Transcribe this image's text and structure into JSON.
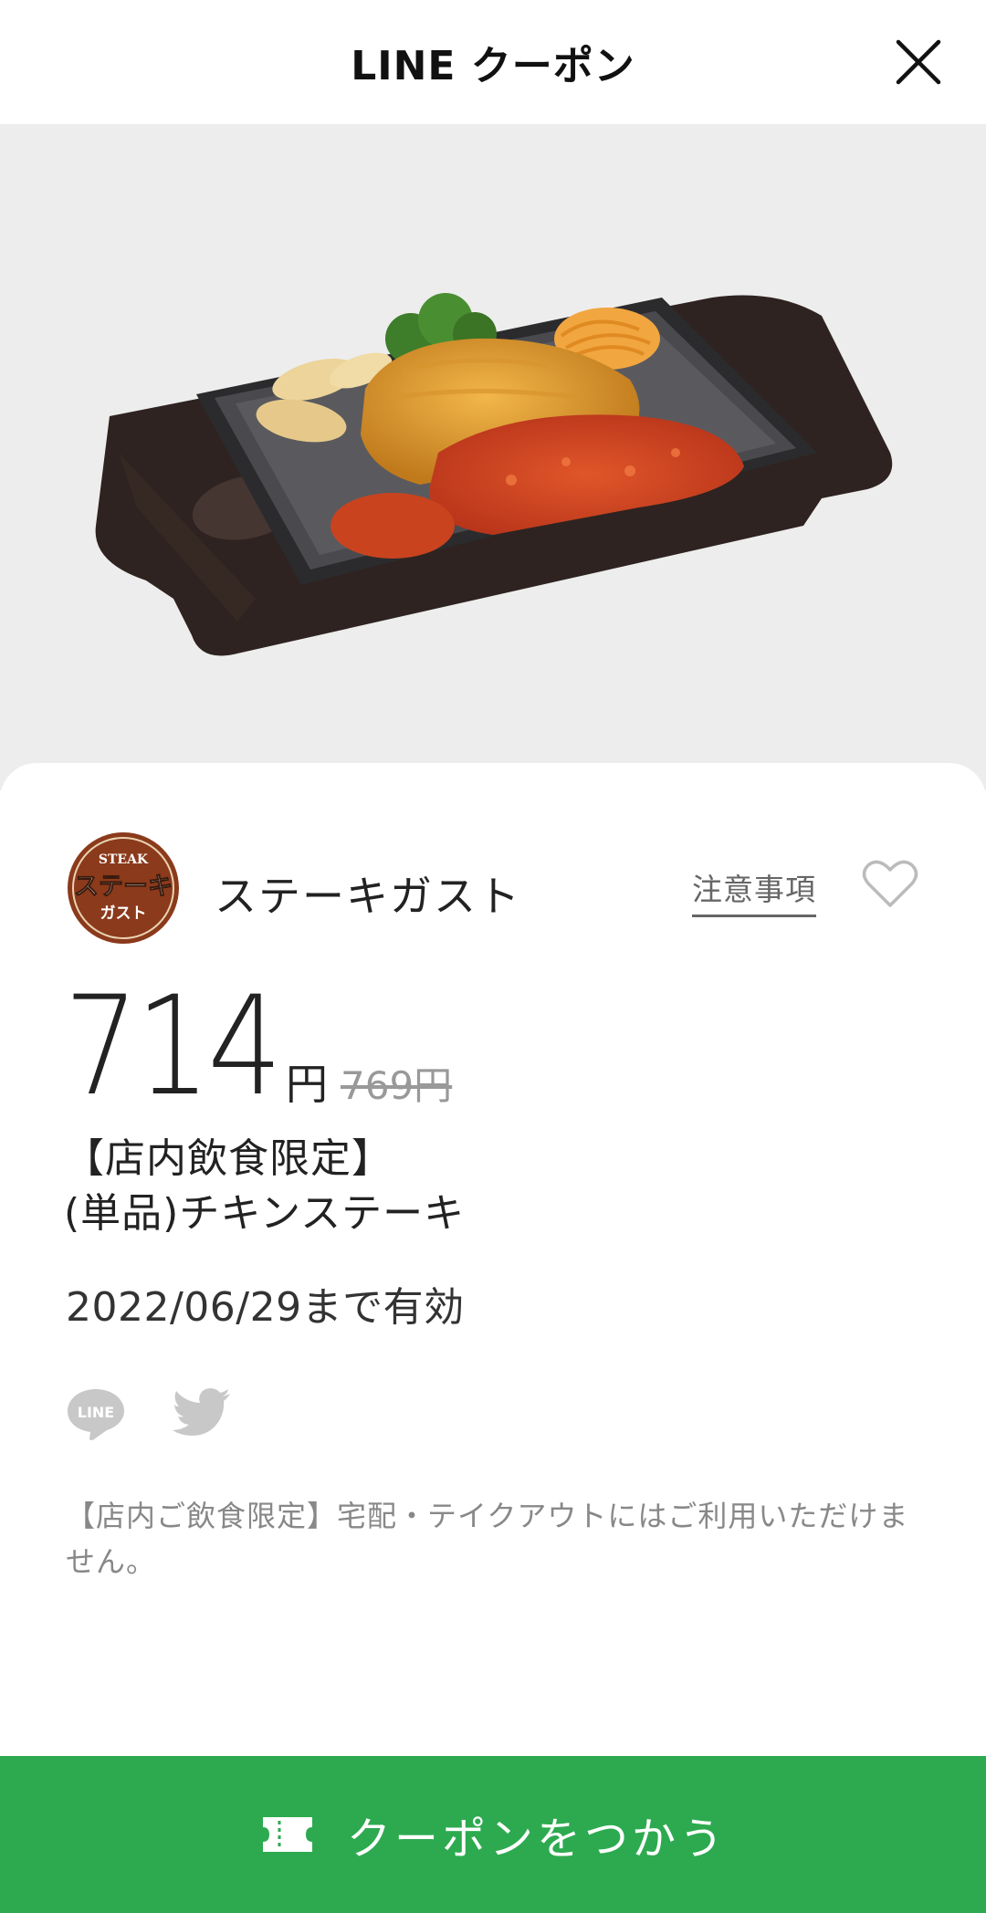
{
  "header": {
    "title": "LINE クーポン"
  },
  "shop": {
    "logo_text_top": "STEAK",
    "logo_text_mid": "ステーキ",
    "logo_text_bottom": "ガスト",
    "name": "ステーキガスト",
    "notice_label": "注意事項"
  },
  "price": {
    "current": "714",
    "unit": "円",
    "original": "769円"
  },
  "coupon": {
    "title_line1": "【店内飲食限定】",
    "title_line2": "(単品)チキンステーキ",
    "valid_until": "2022/06/29まで有効",
    "note": "【店内ご飲食限定】宅配・テイクアウトにはご利用いただけません。"
  },
  "actions": {
    "use_label": "クーポンをつかう"
  },
  "icons": {
    "close": "close-icon",
    "favorite": "heart-icon",
    "share_line": "line-icon",
    "share_twitter": "twitter-icon",
    "ticket": "ticket-icon"
  },
  "colors": {
    "accent_green": "#2daa4f",
    "hero_background": "#ededed",
    "logo_brown": "#8b3a1c"
  }
}
